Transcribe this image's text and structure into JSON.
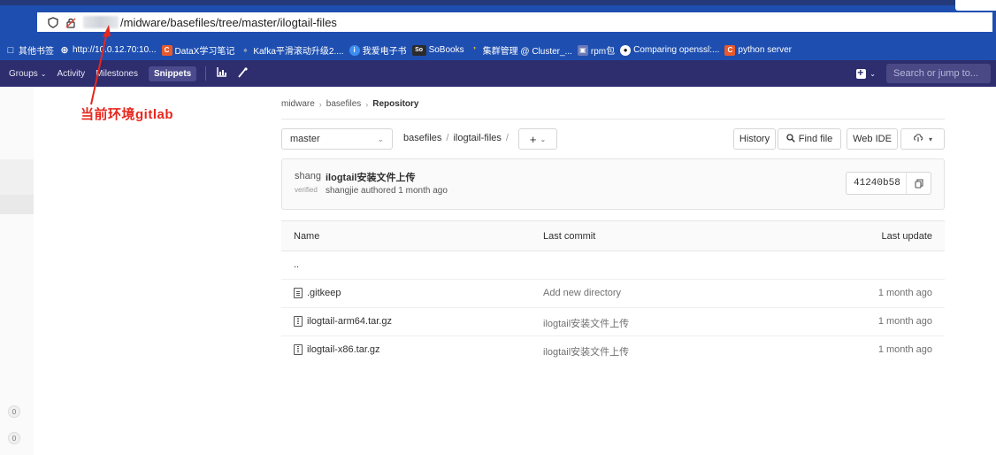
{
  "browser": {
    "url": "/midware/basefiles/tree/master/ilogtail-files",
    "bookmarks": [
      {
        "label": "其他书签",
        "icon": "folder-icon"
      },
      {
        "label": "http://10.0.12.70:10...",
        "icon": "globe-icon"
      },
      {
        "label": "DataX学习笔记",
        "icon": "csdn-icon"
      },
      {
        "label": "Kafka平滑滚动升级2....",
        "icon": "kafka-icon"
      },
      {
        "label": "我爱电子书",
        "icon": "ebook-icon"
      },
      {
        "label": "SoBooks",
        "icon": "sobooks-icon"
      },
      {
        "label": "集群管理 @ Cluster_...",
        "icon": "leaf-icon"
      },
      {
        "label": "rpm包",
        "icon": "image-icon"
      },
      {
        "label": "Comparing openssl:...",
        "icon": "github-icon"
      },
      {
        "label": "python server",
        "icon": "csdn-icon"
      }
    ]
  },
  "navbar": {
    "groups": "Groups",
    "activity": "Activity",
    "milestones": "Milestones",
    "snippets": "Snippets",
    "search_placeholder": "Search or jump to..."
  },
  "annotation": "当前环境gitlab",
  "sidebar": {
    "badges": [
      "0",
      "0"
    ]
  },
  "breadcrumb": {
    "items": [
      "midware",
      "basefiles",
      "Repository"
    ]
  },
  "toolbar": {
    "branch": "master",
    "path": [
      "basefiles",
      "ilogtail-files"
    ],
    "add": "+",
    "history": "History",
    "find_file": "Find file",
    "web_ide": "Web IDE"
  },
  "commit": {
    "avatar_text": "shangjie",
    "avatar_sub": "verified",
    "title": "ilogtail安装文件上传",
    "meta": "shangjie authored 1 month ago",
    "sha": "41240b58"
  },
  "tree": {
    "headers": {
      "name": "Name",
      "last_commit": "Last commit",
      "last_update": "Last update"
    },
    "parent": "..",
    "rows": [
      {
        "name": ".gitkeep",
        "icon": "file-icon",
        "commit": "Add new directory",
        "updated": "1 month ago"
      },
      {
        "name": "ilogtail-arm64.tar.gz",
        "icon": "archive-icon",
        "commit": "ilogtail安装文件上传",
        "updated": "1 month ago"
      },
      {
        "name": "ilogtail-x86.tar.gz",
        "icon": "archive-icon",
        "commit": "ilogtail安装文件上传",
        "updated": "1 month ago"
      }
    ]
  },
  "colors": {
    "navbar": "#2e2d6e",
    "browser_chrome": "#1e4fb0",
    "annotation": "#e8261c"
  }
}
